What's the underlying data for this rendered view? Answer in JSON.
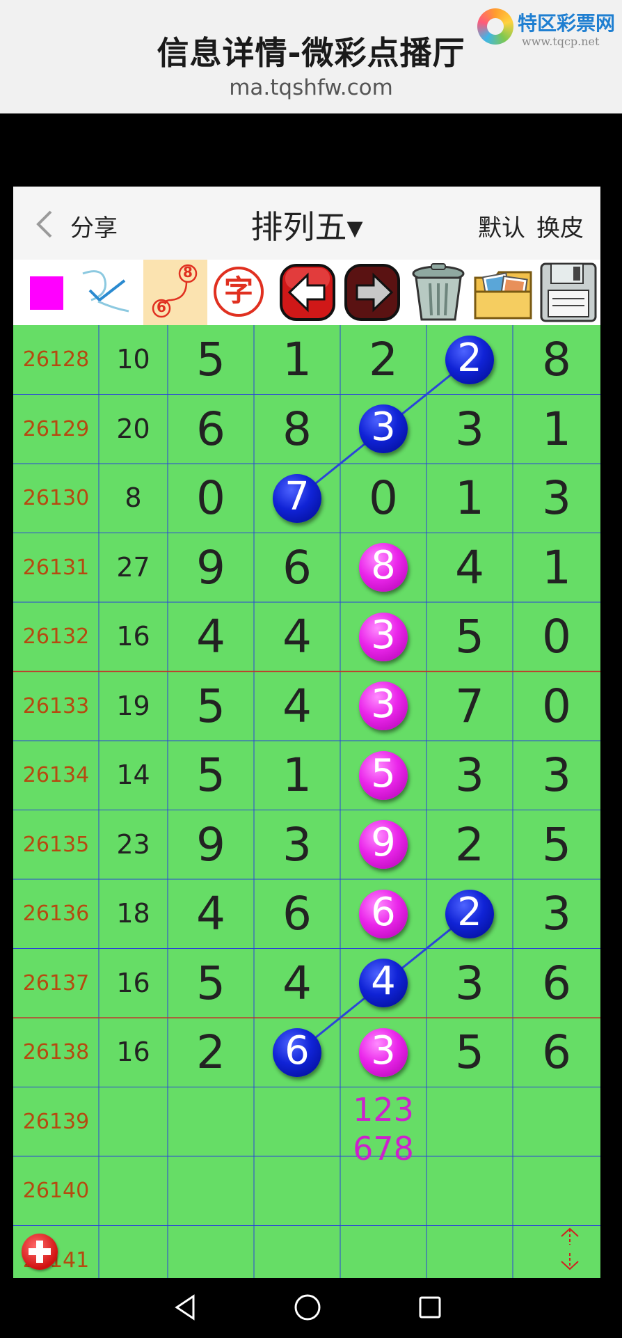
{
  "header": {
    "title": "信息详情-微彩点播厅",
    "url": "ma.tqshfw.com",
    "watermark_name": "特区彩票网",
    "watermark_url": "www.tqcp.net"
  },
  "app": {
    "share_label": "分享",
    "game_title": "排列五▾",
    "default_label": "默认",
    "skin_label": "换皮"
  },
  "toolbar": {
    "tools": [
      {
        "name": "color-swatch-icon",
        "color": "#ff00ff"
      },
      {
        "name": "pen-tool-icon"
      },
      {
        "name": "connect-numbers-icon",
        "top": "8",
        "bottom": "6",
        "selected": true
      },
      {
        "name": "text-char-icon",
        "glyph": "字"
      },
      {
        "name": "undo-arrow-icon"
      },
      {
        "name": "redo-arrow-icon"
      },
      {
        "name": "trash-bin-icon"
      },
      {
        "name": "photos-folder-icon"
      },
      {
        "name": "save-disk-icon"
      }
    ]
  },
  "table": {
    "columns": [
      "issue",
      "sum",
      "d1",
      "d2",
      "d3",
      "d4",
      "d5"
    ],
    "rows": [
      {
        "issue": "26128",
        "sum": "10",
        "digits": [
          "5",
          "1",
          "2",
          "2",
          "8"
        ],
        "marks": [
          {
            "col": 3,
            "style": "blue"
          }
        ]
      },
      {
        "issue": "26129",
        "sum": "20",
        "digits": [
          "6",
          "8",
          "3",
          "3",
          "1"
        ],
        "marks": [
          {
            "col": 2,
            "style": "blue"
          }
        ]
      },
      {
        "issue": "26130",
        "sum": "8",
        "digits": [
          "0",
          "7",
          "0",
          "1",
          "3"
        ],
        "marks": [
          {
            "col": 1,
            "style": "blue"
          }
        ]
      },
      {
        "issue": "26131",
        "sum": "27",
        "digits": [
          "9",
          "6",
          "8",
          "4",
          "1"
        ],
        "marks": [
          {
            "col": 2,
            "style": "pink"
          }
        ]
      },
      {
        "issue": "26132",
        "sum": "16",
        "digits": [
          "4",
          "4",
          "3",
          "5",
          "0"
        ],
        "marks": [
          {
            "col": 2,
            "style": "pink"
          }
        ]
      },
      {
        "issue": "26133",
        "sum": "19",
        "digits": [
          "5",
          "4",
          "3",
          "7",
          "0"
        ],
        "marks": [
          {
            "col": 2,
            "style": "pink"
          }
        ]
      },
      {
        "issue": "26134",
        "sum": "14",
        "digits": [
          "5",
          "1",
          "5",
          "3",
          "3"
        ],
        "marks": [
          {
            "col": 2,
            "style": "pink"
          }
        ]
      },
      {
        "issue": "26135",
        "sum": "23",
        "digits": [
          "9",
          "3",
          "9",
          "2",
          "5"
        ],
        "marks": [
          {
            "col": 2,
            "style": "pink"
          }
        ]
      },
      {
        "issue": "26136",
        "sum": "18",
        "digits": [
          "4",
          "6",
          "6",
          "2",
          "3"
        ],
        "marks": [
          {
            "col": 2,
            "style": "pink"
          },
          {
            "col": 3,
            "style": "blue"
          }
        ]
      },
      {
        "issue": "26137",
        "sum": "16",
        "digits": [
          "5",
          "4",
          "4",
          "3",
          "6"
        ],
        "marks": [
          {
            "col": 2,
            "style": "blue"
          }
        ]
      },
      {
        "issue": "26138",
        "sum": "16",
        "digits": [
          "2",
          "6",
          "3",
          "5",
          "6"
        ],
        "marks": [
          {
            "col": 1,
            "style": "blue"
          },
          {
            "col": 2,
            "style": "pink"
          }
        ]
      },
      {
        "issue": "26139",
        "sum": "",
        "digits": [
          "",
          "",
          "",
          "",
          ""
        ],
        "marks": [],
        "prediction": {
          "col": 2,
          "lines": [
            "123",
            "678"
          ]
        }
      },
      {
        "issue": "26140",
        "sum": "",
        "digits": [
          "",
          "",
          "",
          "",
          ""
        ],
        "marks": []
      },
      {
        "issue": "26141",
        "sum": "",
        "digits": [
          "",
          "",
          "",
          "",
          ""
        ],
        "marks": []
      }
    ],
    "connect_lines": [
      {
        "from_row": 0,
        "from_col": 3,
        "to_row": 2,
        "to_col": 1
      },
      {
        "from_row": 8,
        "from_col": 3,
        "to_row": 10,
        "to_col": 1
      }
    ],
    "colors": {
      "background": "#66dd66",
      "red_line": "#c0392b",
      "blue_line": "#2b45d8",
      "pink_text": "#cc22cc",
      "issue_text": "#b54a10"
    }
  },
  "bottom": {
    "add_icon": "add-plus-icon",
    "scroll_icon": "expand-arrows-icon"
  },
  "navbar": {
    "back": "back-triangle-icon",
    "home": "home-circle-icon",
    "recents": "recents-square-icon"
  }
}
